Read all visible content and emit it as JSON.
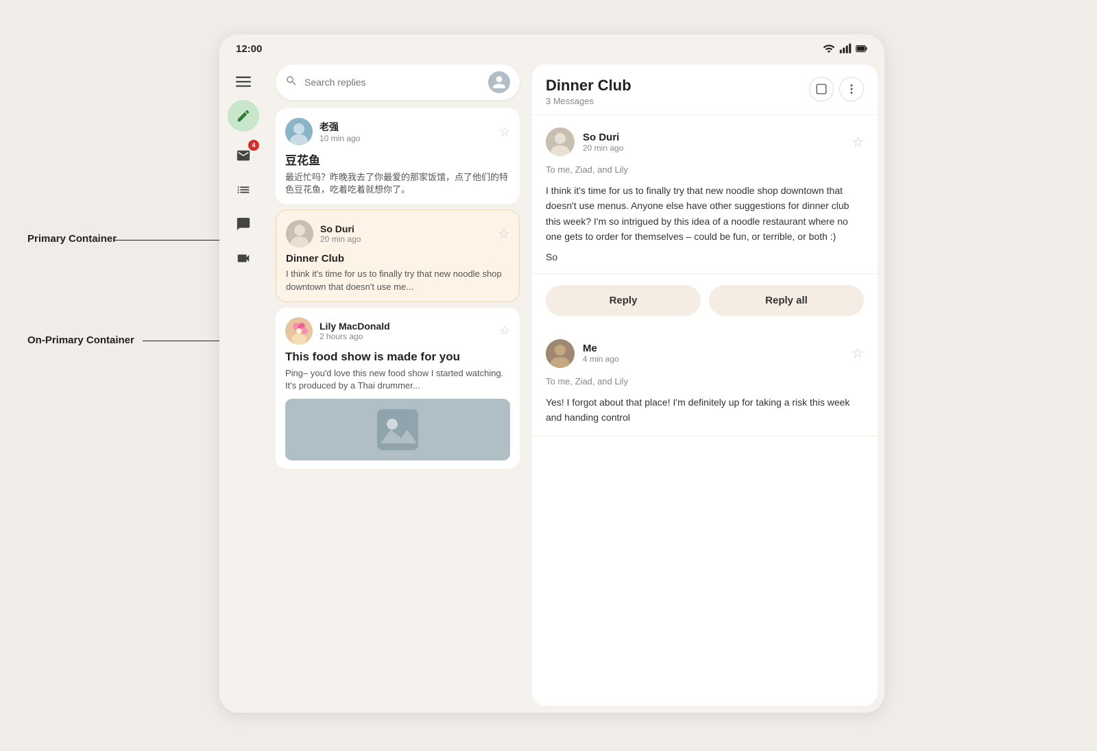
{
  "status_bar": {
    "time": "12:00",
    "icons": [
      "wifi",
      "signal",
      "battery"
    ]
  },
  "labels": {
    "primary_container": "Primary Container",
    "on_primary_container": "On-Primary Container"
  },
  "sidebar": {
    "icons": [
      "menu",
      "compose",
      "inbox_badge",
      "list",
      "chat",
      "video"
    ]
  },
  "search": {
    "placeholder": "Search replies"
  },
  "emails": [
    {
      "sender": "老强",
      "time": "10 min ago",
      "subject": "豆花鱼",
      "preview": "最近忙吗？昨晚我去了你最爱的那家饭馆，点了他们的特色豆花鱼，吃着吃着就想你了。",
      "starred": false,
      "selected": false
    },
    {
      "sender": "So Duri",
      "time": "20 min ago",
      "subject": "Dinner Club",
      "preview": "I think it's time for us to finally try that new noodle shop downtown that doesn't use me...",
      "starred": false,
      "selected": true
    },
    {
      "sender": "Lily MacDonald",
      "time": "2 hours ago",
      "subject": "This food show is made for you",
      "preview": "Ping– you'd love this new food show I started watching. It's produced by a Thai drummer...",
      "starred": false,
      "selected": false
    }
  ],
  "detail": {
    "title": "Dinner Club",
    "count": "3 Messages",
    "messages": [
      {
        "sender": "So Duri",
        "time": "20 min ago",
        "to": "To me, Ziad, and Lily",
        "body": "I think it's time for us to finally try that new noodle shop downtown that doesn't use menus. Anyone else have other suggestions for dinner club this week? I'm so intrigued by this idea of a noodle restaurant where no one gets to order for themselves – could be fun, or terrible, or both :)",
        "sign": "So",
        "avatar_class": "avatar-soduri"
      },
      {
        "sender": "Me",
        "time": "4 min ago",
        "to": "To me, Ziad, and Lily",
        "body": "Yes! I forgot about that place! I'm definitely up for taking a risk this week and handing control",
        "sign": "",
        "avatar_class": "avatar-me"
      }
    ],
    "reply_button": "Reply",
    "reply_all_button": "Reply all"
  },
  "badge_count": "4"
}
